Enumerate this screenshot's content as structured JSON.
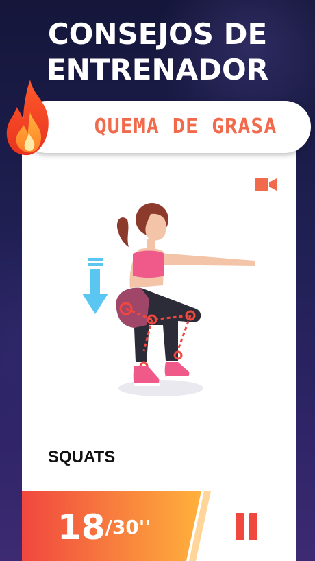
{
  "headline": {
    "line1": "CONSEJOS DE",
    "line2": "ENTRENADOR"
  },
  "banner": {
    "label": "QUEMA DE GRASA",
    "icon": "flame-icon"
  },
  "exercise": {
    "name": "SQUATS",
    "video_icon": "video-camera-icon"
  },
  "timer": {
    "current": "18",
    "total": "/30''"
  },
  "controls": {
    "pause_icon": "pause-icon"
  },
  "colors": {
    "accent": "#f26a4c",
    "timer_start": "#f0473f",
    "timer_end": "#ffb13c",
    "background": "#1f1f52"
  }
}
